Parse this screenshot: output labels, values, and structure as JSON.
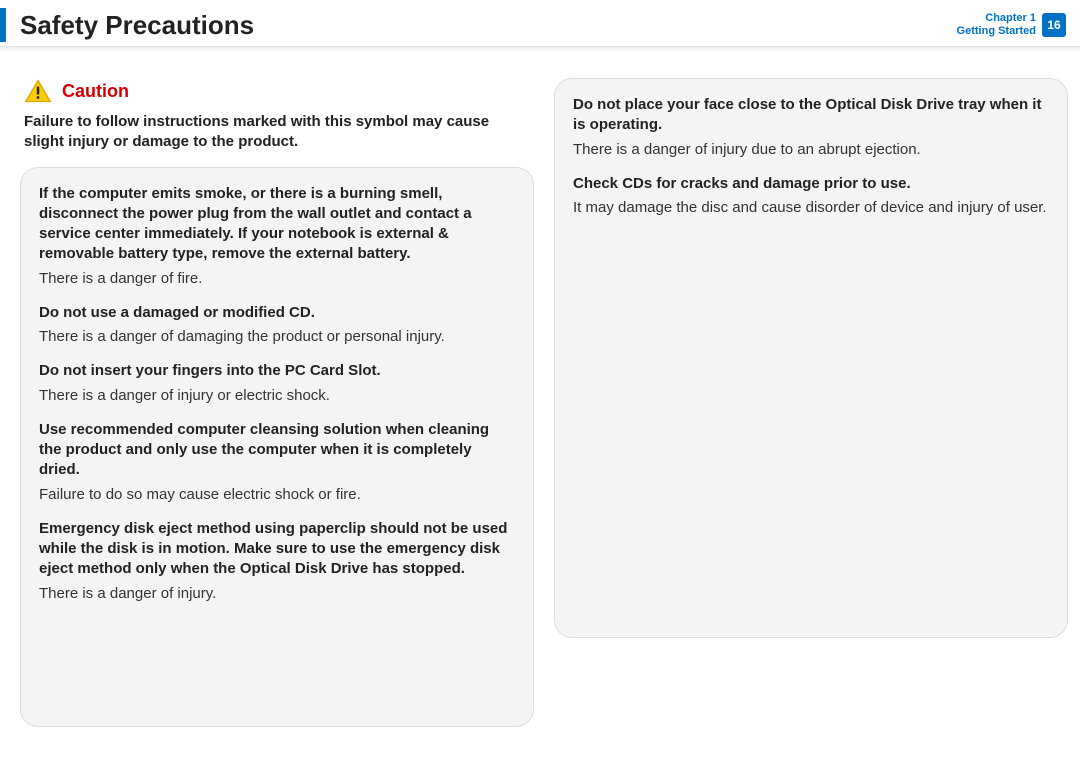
{
  "header": {
    "title": "Safety Precautions",
    "chapter_line1": "Chapter 1",
    "chapter_line2": "Getting Started",
    "page_number": "16"
  },
  "caution": {
    "label": "Caution",
    "intro": "Failure to follow instructions marked with this symbol may cause slight injury or damage to the product."
  },
  "left_items": [
    {
      "heading": "If the computer emits smoke, or there is a burning smell, disconnect the power plug from the wall outlet and contact a service center immediately. If your notebook is external & removable battery type, remove the external battery.",
      "body": "There is a danger of fire."
    },
    {
      "heading": "Do not use a damaged or modified CD.",
      "body": "There is a danger of damaging the product or personal injury."
    },
    {
      "heading": "Do not insert your fingers into the PC Card Slot.",
      "body": "There is a danger of injury or electric shock."
    },
    {
      "heading": "Use recommended computer cleansing solution when cleaning the product and only use the computer when it is completely dried.",
      "body": "Failure to do so may cause electric shock or fire."
    },
    {
      "heading": "Emergency disk eject method using paperclip should not be used while the disk is in motion. Make sure to use the emergency disk eject method only when the Optical Disk Drive has stopped.",
      "body": "There is a danger of injury."
    }
  ],
  "right_items": [
    {
      "heading": "Do not place your face close to the Optical Disk Drive tray when it is operating.",
      "body": "There is a danger of injury due to an abrupt ejection."
    },
    {
      "heading": "Check CDs for cracks and damage prior to use.",
      "body": "It may damage the disc and cause disorder of device and injury of user."
    }
  ]
}
